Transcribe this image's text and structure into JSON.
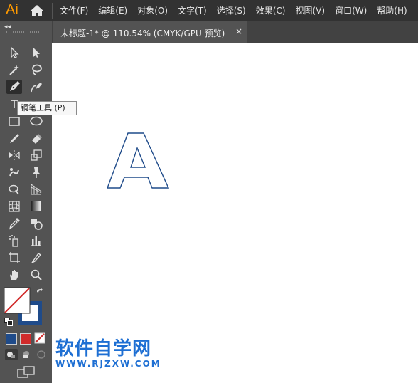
{
  "app": {
    "logo": "Ai",
    "menu": [
      "文件(F)",
      "编辑(E)",
      "对象(O)",
      "文字(T)",
      "选择(S)",
      "效果(C)",
      "视图(V)",
      "窗口(W)",
      "帮助(H)"
    ]
  },
  "document_tab": {
    "title": "未标题-1* @ 110.54% (CMYK/GPU 预览)",
    "close": "×"
  },
  "tooltip": {
    "text": "钢笔工具 (P)"
  },
  "toolbar": {
    "tools": [
      "selection-tool",
      "direct-selection-tool",
      "magic-wand-tool",
      "lasso-tool",
      "pen-tool",
      "curvature-tool",
      "type-tool",
      "line-segment-tool",
      "rectangle-tool",
      "ellipse-tool",
      "paintbrush-tool",
      "eraser-tool",
      "reflect-tool",
      "scale-tool",
      "warp-tool",
      "puppet-warp-tool",
      "shape-builder-tool",
      "perspective-grid-tool",
      "mesh-tool",
      "gradient-tool",
      "eyedropper-tool",
      "blend-tool",
      "symbol-sprayer-tool",
      "column-graph-tool",
      "artboard-tool",
      "slice-tool",
      "hand-tool",
      "zoom-tool"
    ],
    "type_glyph": "T",
    "fill_color": "none",
    "stroke_color": "#1f4b8a",
    "swatch_colors": [
      "#1f4b8a",
      "#d12b2b",
      "none"
    ]
  },
  "canvas": {
    "artwork_letter": "A",
    "outline_color": "#1f4b8a"
  },
  "watermark": {
    "title": "软件自学网",
    "url": "WWW.RJZXW.COM"
  }
}
